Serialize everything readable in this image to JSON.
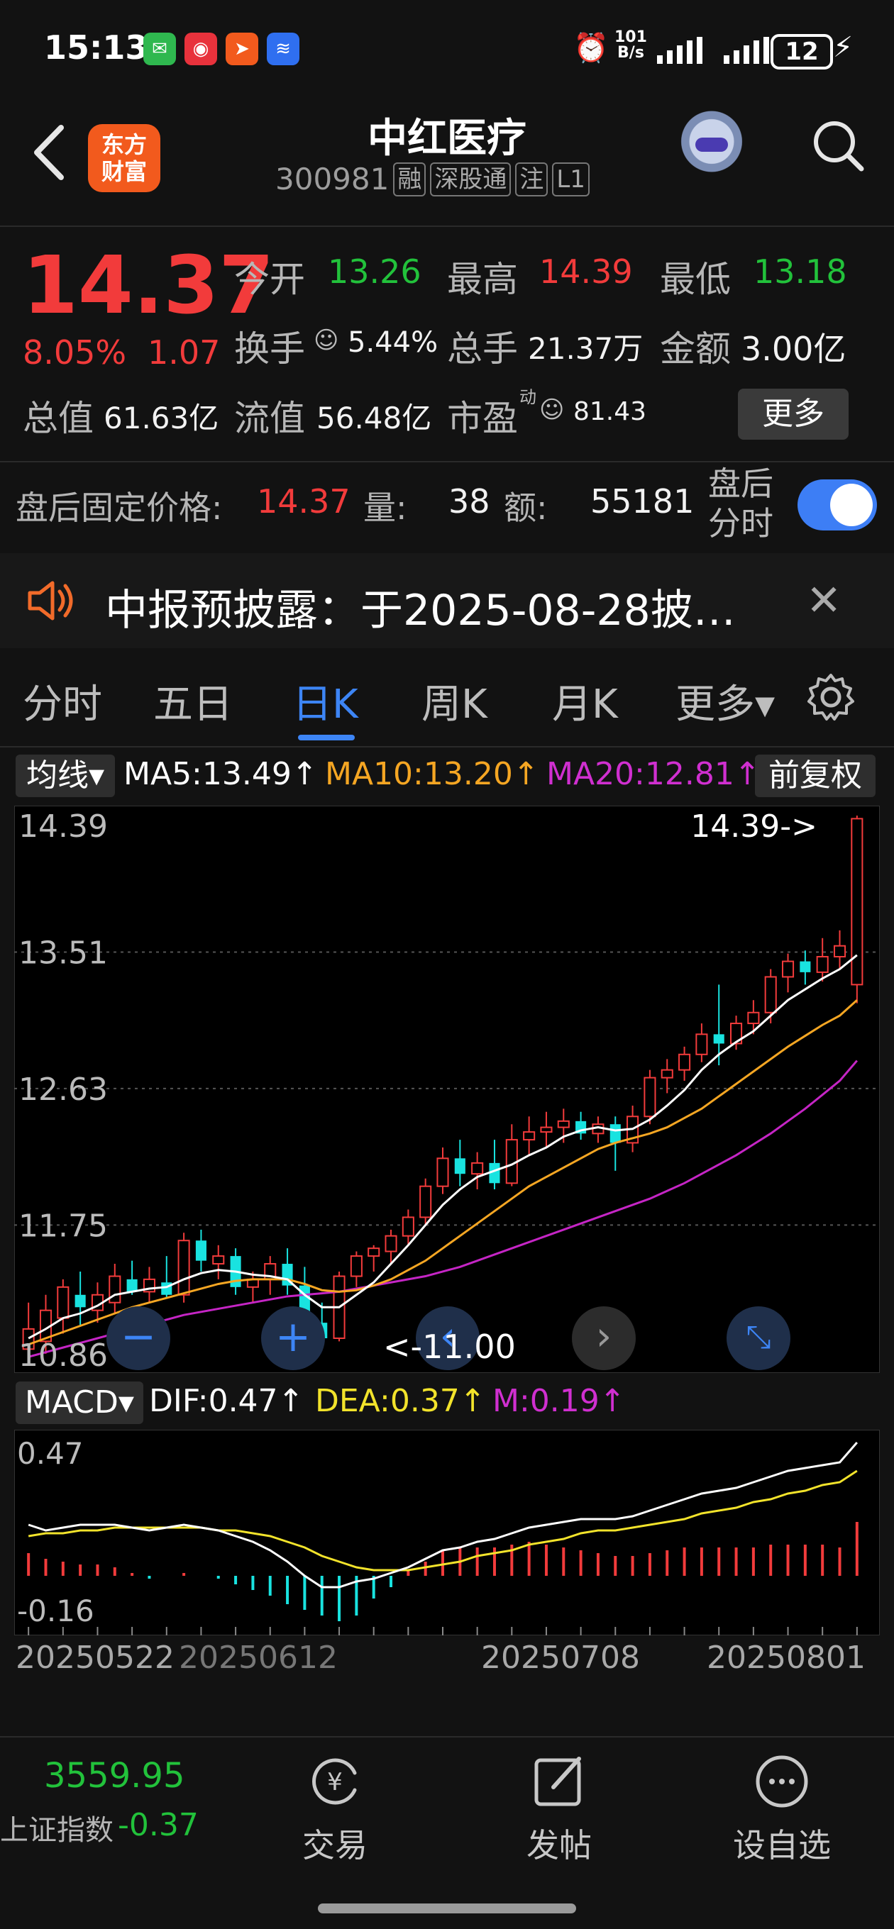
{
  "statusbar": {
    "time": "15:13",
    "net_speed_top": "101",
    "net_speed_bottom": "B/s",
    "battery": "12"
  },
  "header": {
    "logo_line1": "东方",
    "logo_line2": "财富",
    "title": "中红医疗",
    "code": "300981",
    "tags": [
      "融",
      "深股通",
      "注",
      "L1"
    ]
  },
  "quote": {
    "price": "14.37",
    "change_pct": "8.05%",
    "change": "1.07",
    "open_label": "今开",
    "open": "13.26",
    "high_label": "最高",
    "high": "14.39",
    "low_label": "最低",
    "low": "13.18",
    "turnover_label": "换手",
    "turnover": "5.44%",
    "volume_label": "总手",
    "volume": "21.37万",
    "amount_label": "金额",
    "amount": "3.00亿",
    "mktcap_label": "总值",
    "mktcap": "61.63亿",
    "float_label": "流值",
    "float": "56.48亿",
    "pe_label": "市盈",
    "pe_super": "动",
    "pe": "81.43",
    "more": "更多"
  },
  "after_hours": {
    "label": "盘后固定价格:",
    "price": "14.37",
    "vol_label": "量:",
    "vol": "38",
    "amt_label": "额:",
    "amt": "55181",
    "toggle_line1": "盘后",
    "toggle_line2": "分时",
    "toggle_on": true
  },
  "notice": {
    "text": "中报预披露：于2025-08-28披…"
  },
  "tabs": [
    "分时",
    "五日",
    "日K",
    "周K",
    "月K",
    "更多▾"
  ],
  "active_tab": "日K",
  "ma_bar": {
    "selector": "均线▾",
    "ma5": "MA5:13.49↑",
    "ma10": "MA10:13.20↑",
    "ma20": "MA20:12.81↑",
    "adjust": "前复权"
  },
  "colors": {
    "up": "#f23b3b",
    "down": "#22c23b",
    "down_candle": "#19e3e0",
    "ma5": "#ffffff",
    "ma10": "#f5a623",
    "ma20": "#c525c5",
    "dea": "#f2e32b",
    "accent": "#3d85f5"
  },
  "kchart": {
    "y_labels": [
      "14.39",
      "13.51",
      "12.63",
      "11.75",
      "10.86"
    ],
    "ylim": [
      10.86,
      14.39
    ],
    "high_marker": "14.39->",
    "low_marker": "<-11.00",
    "candles": [
      {
        "o": 10.95,
        "h": 11.25,
        "l": 10.88,
        "c": 11.08
      },
      {
        "o": 11.0,
        "h": 11.3,
        "l": 10.92,
        "c": 11.2
      },
      {
        "o": 11.15,
        "h": 11.4,
        "l": 11.05,
        "c": 11.35
      },
      {
        "o": 11.3,
        "h": 11.45,
        "l": 11.1,
        "c": 11.22
      },
      {
        "o": 11.2,
        "h": 11.38,
        "l": 11.12,
        "c": 11.3
      },
      {
        "o": 11.25,
        "h": 11.5,
        "l": 11.18,
        "c": 11.42
      },
      {
        "o": 11.4,
        "h": 11.52,
        "l": 11.3,
        "c": 11.32
      },
      {
        "o": 11.32,
        "h": 11.48,
        "l": 11.25,
        "c": 11.4
      },
      {
        "o": 11.38,
        "h": 11.55,
        "l": 11.28,
        "c": 11.3
      },
      {
        "o": 11.3,
        "h": 11.7,
        "l": 11.25,
        "c": 11.65
      },
      {
        "o": 11.65,
        "h": 11.72,
        "l": 11.45,
        "c": 11.52
      },
      {
        "o": 11.5,
        "h": 11.62,
        "l": 11.4,
        "c": 11.55
      },
      {
        "o": 11.55,
        "h": 11.6,
        "l": 11.3,
        "c": 11.35
      },
      {
        "o": 11.35,
        "h": 11.45,
        "l": 11.25,
        "c": 11.4
      },
      {
        "o": 11.4,
        "h": 11.55,
        "l": 11.3,
        "c": 11.5
      },
      {
        "o": 11.5,
        "h": 11.6,
        "l": 11.3,
        "c": 11.36
      },
      {
        "o": 11.36,
        "h": 11.48,
        "l": 11.05,
        "c": 11.12
      },
      {
        "o": 11.12,
        "h": 11.25,
        "l": 10.98,
        "c": 11.02
      },
      {
        "o": 11.02,
        "h": 11.45,
        "l": 11.0,
        "c": 11.42
      },
      {
        "o": 11.42,
        "h": 11.58,
        "l": 11.35,
        "c": 11.55
      },
      {
        "o": 11.55,
        "h": 11.62,
        "l": 11.45,
        "c": 11.6
      },
      {
        "o": 11.58,
        "h": 11.72,
        "l": 11.5,
        "c": 11.68
      },
      {
        "o": 11.68,
        "h": 11.85,
        "l": 11.62,
        "c": 11.8
      },
      {
        "o": 11.8,
        "h": 12.05,
        "l": 11.75,
        "c": 12.0
      },
      {
        "o": 12.0,
        "h": 12.25,
        "l": 11.95,
        "c": 12.18
      },
      {
        "o": 12.18,
        "h": 12.3,
        "l": 12.0,
        "c": 12.08
      },
      {
        "o": 12.08,
        "h": 12.22,
        "l": 11.98,
        "c": 12.15
      },
      {
        "o": 12.15,
        "h": 12.3,
        "l": 11.98,
        "c": 12.02
      },
      {
        "o": 12.02,
        "h": 12.4,
        "l": 12.0,
        "c": 12.3
      },
      {
        "o": 12.3,
        "h": 12.45,
        "l": 12.2,
        "c": 12.35
      },
      {
        "o": 12.35,
        "h": 12.48,
        "l": 12.25,
        "c": 12.38
      },
      {
        "o": 12.38,
        "h": 12.5,
        "l": 12.28,
        "c": 12.42
      },
      {
        "o": 12.42,
        "h": 12.48,
        "l": 12.3,
        "c": 12.34
      },
      {
        "o": 12.34,
        "h": 12.45,
        "l": 12.28,
        "c": 12.4
      },
      {
        "o": 12.4,
        "h": 12.45,
        "l": 12.1,
        "c": 12.28
      },
      {
        "o": 12.28,
        "h": 12.52,
        "l": 12.22,
        "c": 12.45
      },
      {
        "o": 12.45,
        "h": 12.75,
        "l": 12.4,
        "c": 12.7
      },
      {
        "o": 12.7,
        "h": 12.82,
        "l": 12.6,
        "c": 12.75
      },
      {
        "o": 12.75,
        "h": 12.9,
        "l": 12.68,
        "c": 12.85
      },
      {
        "o": 12.85,
        "h": 13.05,
        "l": 12.8,
        "c": 12.98
      },
      {
        "o": 12.98,
        "h": 13.3,
        "l": 12.78,
        "c": 12.92
      },
      {
        "o": 12.92,
        "h": 13.1,
        "l": 12.88,
        "c": 13.05
      },
      {
        "o": 13.05,
        "h": 13.2,
        "l": 12.98,
        "c": 13.12
      },
      {
        "o": 13.12,
        "h": 13.4,
        "l": 13.05,
        "c": 13.35
      },
      {
        "o": 13.35,
        "h": 13.5,
        "l": 13.25,
        "c": 13.45
      },
      {
        "o": 13.45,
        "h": 13.52,
        "l": 13.3,
        "c": 13.38
      },
      {
        "o": 13.38,
        "h": 13.6,
        "l": 13.32,
        "c": 13.48
      },
      {
        "o": 13.48,
        "h": 13.65,
        "l": 13.4,
        "c": 13.55
      },
      {
        "o": 13.3,
        "h": 14.39,
        "l": 13.18,
        "c": 14.37
      }
    ],
    "ma5": [
      11.02,
      11.08,
      11.15,
      11.18,
      11.23,
      11.3,
      11.32,
      11.34,
      11.35,
      11.4,
      11.44,
      11.46,
      11.45,
      11.43,
      11.42,
      11.4,
      11.3,
      11.22,
      11.22,
      11.3,
      11.38,
      11.5,
      11.62,
      11.75,
      11.88,
      11.98,
      12.06,
      12.1,
      12.14,
      12.2,
      12.25,
      12.32,
      12.36,
      12.38,
      12.36,
      12.37,
      12.43,
      12.52,
      12.62,
      12.75,
      12.85,
      12.93,
      13.0,
      13.1,
      13.2,
      13.27,
      13.34,
      13.4,
      13.49
    ],
    "ma10": [
      10.98,
      11.02,
      11.06,
      11.1,
      11.14,
      11.18,
      11.22,
      11.25,
      11.28,
      11.31,
      11.34,
      11.37,
      11.39,
      11.4,
      11.4,
      11.4,
      11.37,
      11.33,
      11.32,
      11.33,
      11.36,
      11.4,
      11.46,
      11.52,
      11.6,
      11.68,
      11.76,
      11.84,
      11.92,
      12.0,
      12.06,
      12.12,
      12.18,
      12.24,
      12.28,
      12.31,
      12.34,
      12.38,
      12.44,
      12.5,
      12.58,
      12.66,
      12.74,
      12.82,
      12.9,
      12.97,
      13.04,
      13.1,
      13.2
    ],
    "ma20": [
      10.9,
      10.93,
      10.96,
      10.99,
      11.02,
      11.05,
      11.08,
      11.11,
      11.14,
      11.17,
      11.19,
      11.21,
      11.23,
      11.25,
      11.27,
      11.29,
      11.3,
      11.31,
      11.32,
      11.34,
      11.36,
      11.38,
      11.4,
      11.42,
      11.45,
      11.48,
      11.52,
      11.56,
      11.6,
      11.64,
      11.68,
      11.72,
      11.76,
      11.8,
      11.84,
      11.88,
      11.92,
      11.97,
      12.02,
      12.08,
      12.14,
      12.2,
      12.27,
      12.34,
      12.42,
      12.5,
      12.59,
      12.68,
      12.81
    ]
  },
  "macd_bar": {
    "selector": "MACD▾",
    "dif": "DIF:0.47↑",
    "dea": "DEA:0.37↑",
    "m": "M:0.19↑"
  },
  "macd": {
    "y_labels": [
      "0.47",
      "-0.16"
    ],
    "ylim": [
      -0.16,
      0.47
    ],
    "dif": [
      0.18,
      0.16,
      0.17,
      0.18,
      0.18,
      0.18,
      0.17,
      0.16,
      0.17,
      0.18,
      0.17,
      0.16,
      0.14,
      0.12,
      0.09,
      0.05,
      0.0,
      -0.04,
      -0.04,
      -0.02,
      -0.01,
      0.01,
      0.03,
      0.06,
      0.09,
      0.1,
      0.12,
      0.13,
      0.15,
      0.17,
      0.18,
      0.19,
      0.2,
      0.2,
      0.2,
      0.21,
      0.23,
      0.25,
      0.27,
      0.29,
      0.3,
      0.31,
      0.33,
      0.35,
      0.37,
      0.38,
      0.39,
      0.4,
      0.47
    ],
    "dea": [
      0.14,
      0.15,
      0.15,
      0.16,
      0.16,
      0.17,
      0.17,
      0.17,
      0.17,
      0.17,
      0.17,
      0.16,
      0.16,
      0.15,
      0.14,
      0.12,
      0.1,
      0.07,
      0.05,
      0.03,
      0.02,
      0.02,
      0.02,
      0.03,
      0.04,
      0.05,
      0.07,
      0.08,
      0.09,
      0.11,
      0.12,
      0.13,
      0.15,
      0.16,
      0.16,
      0.17,
      0.18,
      0.19,
      0.2,
      0.22,
      0.23,
      0.24,
      0.26,
      0.27,
      0.29,
      0.3,
      0.32,
      0.33,
      0.37
    ],
    "m": [
      0.08,
      0.06,
      0.05,
      0.04,
      0.04,
      0.03,
      0.01,
      -0.01,
      0.0,
      0.01,
      0.0,
      -0.01,
      -0.03,
      -0.05,
      -0.07,
      -0.1,
      -0.12,
      -0.14,
      -0.16,
      -0.14,
      -0.08,
      -0.04,
      0.02,
      0.05,
      0.09,
      0.1,
      0.1,
      0.1,
      0.11,
      0.12,
      0.11,
      0.1,
      0.09,
      0.08,
      0.07,
      0.07,
      0.08,
      0.09,
      0.1,
      0.1,
      0.1,
      0.1,
      0.1,
      0.11,
      0.11,
      0.11,
      0.11,
      0.1,
      0.19
    ]
  },
  "date_labels": [
    "20250522",
    "20250612",
    "20250708",
    "20250801"
  ],
  "bottom": {
    "index_value": "3559.95",
    "index_name": "上证指数",
    "index_change": "-0.37",
    "trade": "交易",
    "post": "发帖",
    "watchlist": "设自选"
  }
}
